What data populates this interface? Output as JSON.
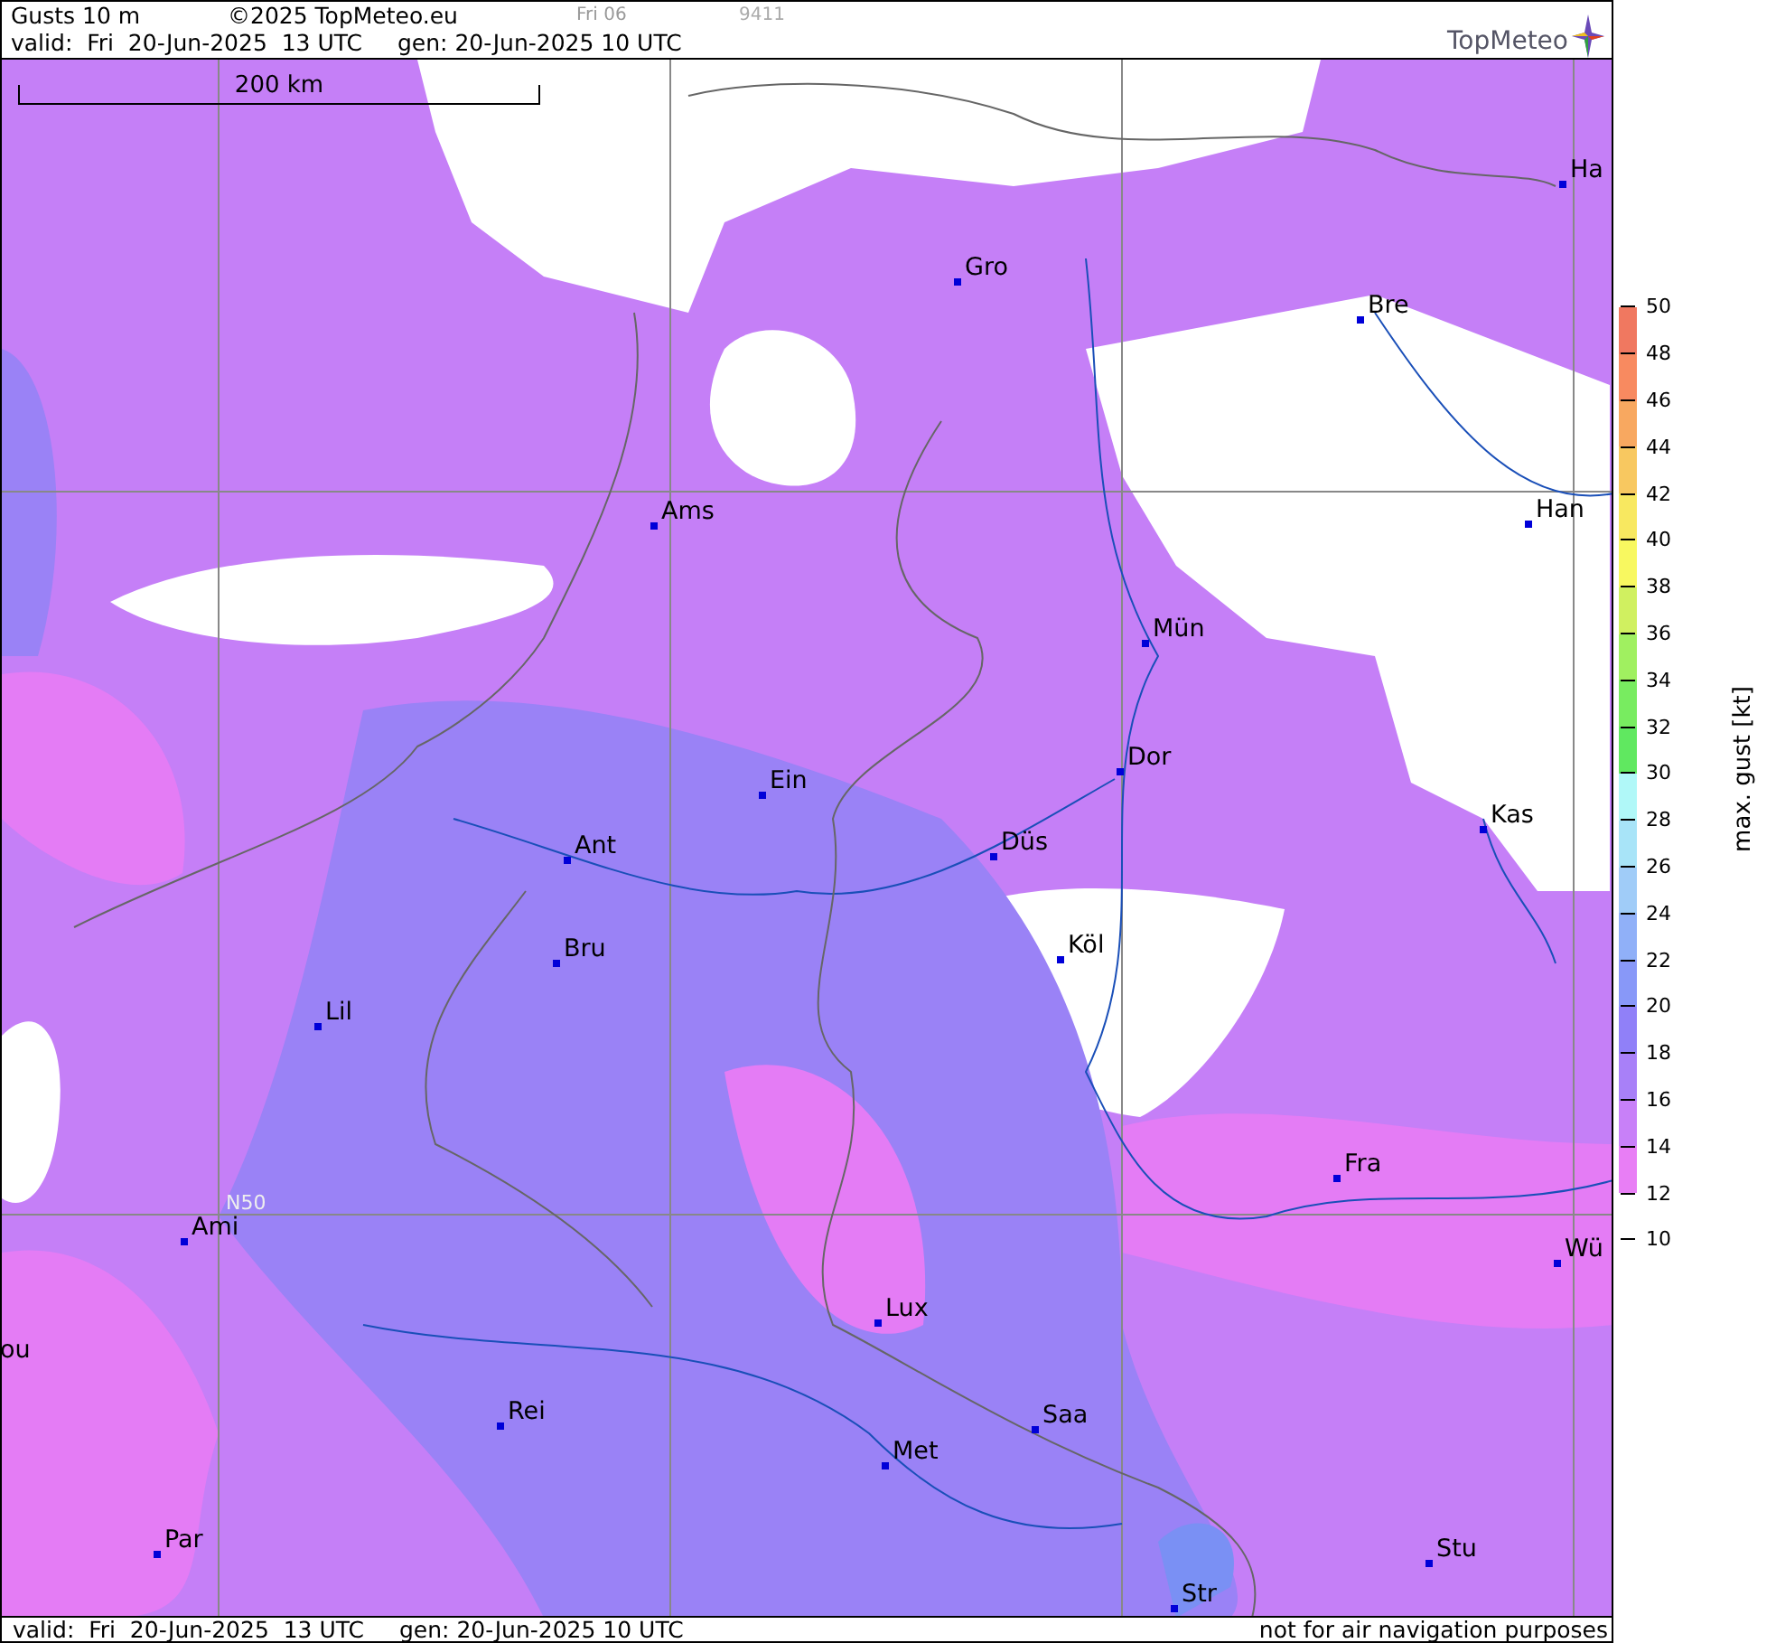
{
  "header": {
    "title": "Gusts 10 m",
    "copyright": "©2025 TopMeteo.eu",
    "run_label": "Fri 06",
    "code": "9411",
    "valid": "valid:  Fri  20-Jun-2025  13 UTC",
    "generated": "gen: 20-Jun-2025 10 UTC",
    "logo": "TopMeteo"
  },
  "map": {
    "scale_label": "200 km",
    "latitude_label": "N50",
    "cities": [
      {
        "name": "Ha"
      },
      {
        "name": "Gro"
      },
      {
        "name": "Bre"
      },
      {
        "name": "Ams"
      },
      {
        "name": "Han"
      },
      {
        "name": "Mün"
      },
      {
        "name": "Dor"
      },
      {
        "name": "Ein"
      },
      {
        "name": "Düs"
      },
      {
        "name": "Kas"
      },
      {
        "name": "Ant"
      },
      {
        "name": "Köl"
      },
      {
        "name": "Bru"
      },
      {
        "name": "Lil"
      },
      {
        "name": "Fra"
      },
      {
        "name": "Ami"
      },
      {
        "name": "Wü"
      },
      {
        "name": "ou"
      },
      {
        "name": "Lux"
      },
      {
        "name": "Rei"
      },
      {
        "name": "Saa"
      },
      {
        "name": "Met"
      },
      {
        "name": "Par"
      },
      {
        "name": "Stu"
      },
      {
        "name": "Str"
      }
    ]
  },
  "legend": {
    "title": "max. gust [kt]",
    "ticks": [
      "50",
      "48",
      "46",
      "44",
      "42",
      "40",
      "38",
      "36",
      "34",
      "32",
      "30",
      "28",
      "26",
      "24",
      "22",
      "20",
      "18",
      "16",
      "14",
      "12",
      "10"
    ],
    "bands": [
      {
        "color": "#f07860"
      },
      {
        "color": "#f88a60"
      },
      {
        "color": "#f8a860"
      },
      {
        "color": "#f8c860"
      },
      {
        "color": "#f8e860"
      },
      {
        "color": "#f8f860"
      },
      {
        "color": "#d0f060"
      },
      {
        "color": "#a0f060"
      },
      {
        "color": "#78ec60"
      },
      {
        "color": "#60e860"
      },
      {
        "color": "#b0f8f8"
      },
      {
        "color": "#a8e4f8"
      },
      {
        "color": "#a0ccf8"
      },
      {
        "color": "#90b0f8"
      },
      {
        "color": "#8898f8"
      },
      {
        "color": "#9080f8"
      },
      {
        "color": "#a880f8"
      },
      {
        "color": "#c880f8"
      },
      {
        "color": "#e87ef5"
      }
    ]
  },
  "footer": {
    "valid": "valid:  Fri  20-Jun-2025  13 UTC",
    "generated": "gen: 20-Jun-2025 10 UTC",
    "disclaimer": "not for air navigation purposes"
  }
}
